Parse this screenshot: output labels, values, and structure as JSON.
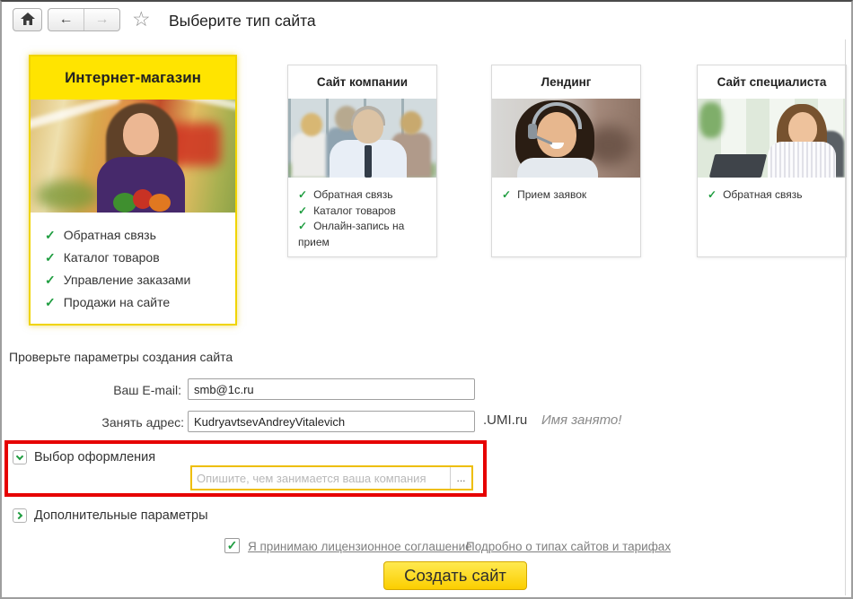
{
  "window": {
    "title": "Выберите тип сайта"
  },
  "icons": {
    "back": "←",
    "forward": "→",
    "star": "☆",
    "check": "✓",
    "ellipsis": "..."
  },
  "colors": {
    "accent_yellow": "#ffe400",
    "check_green": "#1f9d40",
    "highlight_red": "#e60000",
    "link_gray": "#7f7f7f",
    "focus_border_yellow": "#eebe00"
  },
  "cards": [
    {
      "title": "Интернет-магазин",
      "selected": true,
      "features": [
        "Обратная связь",
        "Каталог товаров",
        "Управление заказами",
        "Продажи на сайте"
      ]
    },
    {
      "title": "Сайт компании",
      "selected": false,
      "features": [
        "Обратная связь",
        "Каталог товаров",
        "Онлайн-запись на прием"
      ]
    },
    {
      "title": "Лендинг",
      "selected": false,
      "features": [
        "Прием заявок"
      ]
    },
    {
      "title": "Сайт специалиста",
      "selected": false,
      "features": [
        "Обратная связь"
      ]
    }
  ],
  "form": {
    "section_title": "Проверьте параметры создания сайта",
    "email_label": "Ваш E-mail:",
    "email_value": "smb@1c.ru",
    "address_label": "Занять адрес:",
    "address_value": "KudryavtsevAndreyVitalevich",
    "domain_suffix": ".UMI.ru",
    "name_taken_message": "Имя занято!",
    "design_section_label": "Выбор оформления",
    "design_input_placeholder": "Опишите, чем занимается ваша компания",
    "more_params_label": "Дополнительные параметры",
    "license_link": "Я принимаю лицензионное  соглашение",
    "tariffs_link": "Подробно о типах сайтов и тарифах",
    "submit_label": "Создать сайт"
  }
}
